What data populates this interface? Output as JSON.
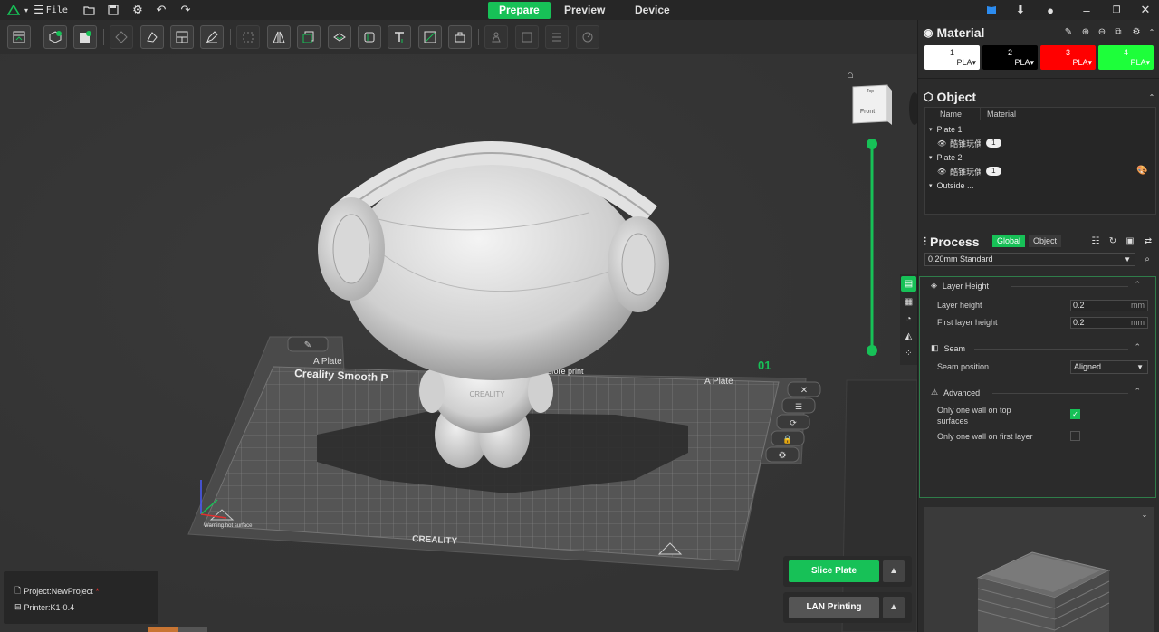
{
  "topbar": {
    "file_label": "File",
    "tabs": [
      {
        "label": "Prepare",
        "active": true
      },
      {
        "label": "Preview",
        "active": false
      },
      {
        "label": "Device",
        "active": false
      }
    ],
    "accent": "#17c157"
  },
  "toolbar": {
    "icons": [
      "plate-view-icon",
      "add-object-icon",
      "add-plate-icon",
      "auto-orient-icon",
      "arrange-icon",
      "layout-icon",
      "scale-icon",
      "mirror-icon",
      "copy-icon",
      "support-paint-icon",
      "seam-paint-icon",
      "text-icon",
      "color-paint-icon",
      "cut-icon",
      "measure-icon",
      "assembly-icon",
      "list-icon",
      "timer-icon"
    ]
  },
  "viewport": {
    "view_cube_label": "Front",
    "view_cube_top": "Top",
    "plate_name": "A Plate",
    "plate_number": "01",
    "plate_brand": "Creality Smooth P",
    "plate_notice": "Before print",
    "plate_footer": "CREALITY",
    "model_label": "CREALITY",
    "warning": "Warning hot surface"
  },
  "material": {
    "title": "Material",
    "slots": [
      {
        "num": "1",
        "type": "PLA",
        "color": "#ffffff",
        "text": "#222222"
      },
      {
        "num": "2",
        "type": "PLA",
        "color": "#000000",
        "text": "#ffffff"
      },
      {
        "num": "3",
        "type": "PLA",
        "color": "#ff0000",
        "text": "#ffffff"
      },
      {
        "num": "4",
        "type": "PLA",
        "color": "#1dff3a",
        "text": "#ffffff"
      }
    ]
  },
  "object": {
    "title": "Object",
    "col_name": "Name",
    "col_material": "Material",
    "rows": [
      {
        "label": "Plate 1"
      },
      {
        "label": "酷锥玩偶",
        "material": "1"
      },
      {
        "label": "Plate 2"
      },
      {
        "label": "酷锥玩偶-I",
        "material": "1"
      },
      {
        "label": "Outside ..."
      }
    ]
  },
  "process": {
    "title": "Process",
    "tab_global": "Global",
    "tab_object": "Object",
    "preset": "0.20mm Standard",
    "sections": {
      "layer_height": "Layer Height",
      "seam": "Seam",
      "advanced": "Advanced"
    },
    "fields": {
      "layer_height_label": "Layer height",
      "layer_height_value": "0.2",
      "first_layer_label": "First layer height",
      "first_layer_value": "0.2",
      "unit": "mm",
      "seam_label": "Seam position",
      "seam_value": "Aligned",
      "one_wall_top_label": "Only one wall on top surfaces",
      "one_wall_top_checked": true,
      "one_wall_first_label": "Only one wall on first layer",
      "one_wall_first_checked": false
    }
  },
  "actions": {
    "slice_label": "Slice Plate",
    "lan_label": "LAN Printing"
  },
  "project": {
    "project_label": "Project:NewProject",
    "modified_mark": "*",
    "printer_label": "Printer:K1-0.4"
  }
}
